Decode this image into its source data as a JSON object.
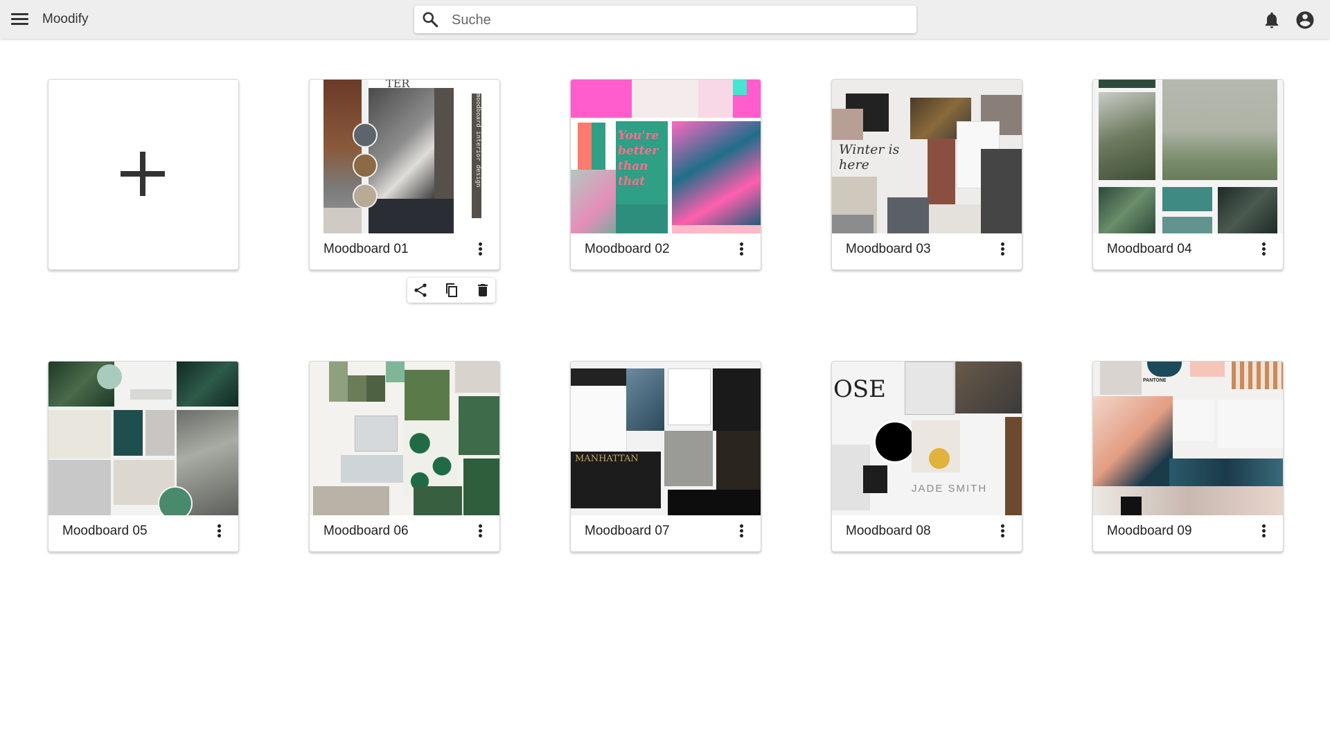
{
  "app": {
    "title": "Moodify",
    "menu_icon": "hamburger-menu-icon",
    "search": {
      "placeholder": "Suche",
      "value": ""
    },
    "icons": [
      "search-icon",
      "notifications-bell-icon",
      "account-circle-icon"
    ]
  },
  "new_board": {
    "icon": "plus-icon"
  },
  "boards": [
    {
      "title": "Moodboard 01",
      "thumb_text": "moodboard interior design",
      "palette": [
        "#5d646b",
        "#8b6a45",
        "#b7ab98"
      ]
    },
    {
      "title": "Moodboard 02",
      "thumb_text": "You're better than that",
      "palette": [
        "#ff5ccd",
        "#2f9f86",
        "#ff7a6e"
      ]
    },
    {
      "title": "Moodboard 03",
      "thumb_text": "Winter is here",
      "palette": [
        "#5a5a5a",
        "#d9d6d1",
        "#3c3c3c"
      ]
    },
    {
      "title": "Moodboard 04",
      "thumb_text": "",
      "palette": [
        "#3f8a83",
        "#62938e",
        "#2b4a3a"
      ]
    },
    {
      "title": "Moodboard 05",
      "thumb_text": "",
      "palette": [
        "#1e4e4e",
        "#a9cbbd",
        "#4a8a6c"
      ]
    },
    {
      "title": "Moodboard 06",
      "thumb_text": "",
      "palette": [
        "#8fa07f",
        "#6a7c58",
        "#2f6b45"
      ]
    },
    {
      "title": "Moodboard 07",
      "thumb_text": "MANHATTAN",
      "palette": [
        "#1c1c1c",
        "#c7a65a",
        "#3a3a3a"
      ]
    },
    {
      "title": "Moodboard 08",
      "thumb_text": "JADE SMITH",
      "palette": [
        "#000000",
        "#e0b33c",
        "#8a8a8a"
      ]
    },
    {
      "title": "Moodboard 09",
      "thumb_text": "PANTONE",
      "palette": [
        "#1b4a5a",
        "#f5c5b8",
        "#e39d83"
      ]
    }
  ],
  "card_menu": {
    "icon": "more-vert-icon"
  },
  "action_popup": {
    "icons": [
      "share-icon",
      "copy-icon",
      "delete-icon"
    ]
  }
}
